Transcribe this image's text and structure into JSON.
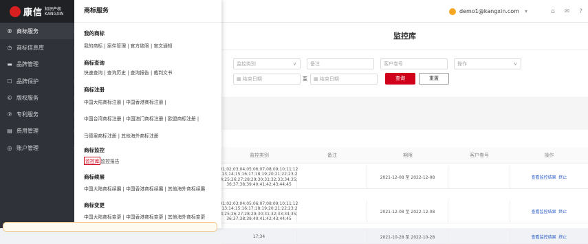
{
  "logo": {
    "text": "康信",
    "sub1": "知识产权",
    "sub2": "KANGXIN"
  },
  "sidebar": {
    "items": [
      {
        "label": "商标服务",
        "icon": "®"
      },
      {
        "label": "商标信息库",
        "icon": "◷"
      },
      {
        "label": "品牌管理",
        "icon": "▬"
      },
      {
        "label": "品牌保护",
        "icon": "☐"
      },
      {
        "label": "版权服务",
        "icon": "©"
      },
      {
        "label": "专利服务",
        "icon": "℗"
      },
      {
        "label": "费用管理",
        "icon": "▤"
      },
      {
        "label": "账户管理",
        "icon": "◎"
      }
    ]
  },
  "header": {
    "user": "demo1@kangxin.com"
  },
  "panel": {
    "title": "商标服务",
    "groups": [
      {
        "title": "我的商标",
        "links": [
          "我的商标 | 案件管理 | 官方绝限 | 官文通知"
        ]
      },
      {
        "title": "商标查询",
        "links": [
          "快速查询 | 查询历史 | 查询报告 | 裁判文书"
        ]
      },
      {
        "title": "商标注册",
        "links": [
          "中国大陆商标注册 | 中国香港商标注册 |",
          "中国台湾商标注册 | 中国澳门商标注册 | 欧盟商标注册 |",
          "马德里商标注册 | 其他海外商标注册"
        ]
      },
      {
        "title": "商标监控",
        "links": [
          "监控库",
          "监控报告"
        ]
      },
      {
        "title": "商标续展",
        "links": [
          "中国大陆商标续展 | 中国香港商标续展 | 其他海外商标续展"
        ]
      },
      {
        "title": "商标变更",
        "links": [
          "中国大陆商标变更 | 中国香港商标变更 | 其他海外商标变更"
        ]
      }
    ]
  },
  "main": {
    "title": "监控库",
    "filters": {
      "category_placeholder": "监控类别",
      "remark_placeholder": "备注",
      "client_placeholder": "客户卷号",
      "op_placeholder": "操作",
      "end_date_placeholder": "结束日期",
      "to": "至",
      "search_label": "查询",
      "reset_label": "重置"
    },
    "columns": [
      "监控类别",
      "备注",
      "期限",
      "客户卷号",
      "操作"
    ],
    "rows": [
      {
        "types": "01;02;03;04;05;06;07;08;09;10;11;12\n;13;14;15;16;17;18;19;20;21;22;23;2\n4;25;26;27;28;29;30;31;32;33;34;35;\n36;37;38;39;40;41;42;43;44;45",
        "remark": "",
        "period": "2021-12-08 至 2022-12-08",
        "client": "",
        "view": "查看监控结果",
        "stop": "终止"
      },
      {
        "types": "01;02;03;04;05;06;07;08;09;10;11;12\n;13;14;15;16;17;18;19;20;21;22;23;2\n4;25;26;27;28;29;30;31;32;33;34;35;\n36;37;38;39;40;41;42;43;44;45",
        "remark": "",
        "period": "2021-12-08 至 2022-12-08",
        "client": "",
        "view": "查看监控结果",
        "stop": "终止"
      },
      {
        "types": "17;34",
        "remark": "",
        "period": "2021-10-28 至 2022-10-28",
        "client": "",
        "view": "查看监控结果",
        "stop": "终止"
      }
    ]
  }
}
